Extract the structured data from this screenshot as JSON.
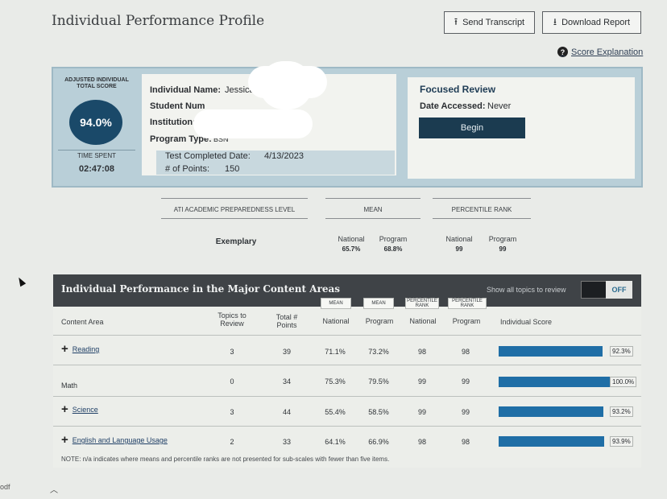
{
  "header": {
    "title": "Individual Performance Profile",
    "send_transcript": "Send Transcript",
    "download_report": "Download Report",
    "score_explanation": "Score Explanation"
  },
  "score": {
    "label": "ADJUSTED INDIVIDUAL TOTAL SCORE",
    "value": "94.0%",
    "time_label": "TIME SPENT",
    "time_value": "02:47:08"
  },
  "individual": {
    "name_label": "Individual Name:",
    "name_value": "Jessica",
    "student_label": "Student Num",
    "institution_label": "Institution:",
    "program_label": "Program Type:",
    "program_value": "BSN",
    "test_completed_label": "Test Completed Date:",
    "test_completed_value": "4/13/2023",
    "points_label": "# of Points:",
    "points_value": "150"
  },
  "focused_review": {
    "title": "Focused Review",
    "date_label": "Date Accessed:",
    "date_value": "Never",
    "begin": "Begin"
  },
  "summary": {
    "level_header": "ATI ACADEMIC PREPAREDNESS LEVEL",
    "level_value": "Exemplary",
    "mean_header": "MEAN",
    "percentile_header": "PERCENTILE RANK",
    "national_label": "National",
    "program_label": "Program",
    "mean_national": "65.7%",
    "mean_program": "68.8%",
    "pr_national": "99",
    "pr_program": "99"
  },
  "content": {
    "title": "Individual Performance in the Major Content Areas",
    "show_all": "Show all topics to review",
    "toggle": "OFF",
    "headers": {
      "content_area": "Content Area",
      "topics": "Topics to Review",
      "total": "Total # Points",
      "mean_box": "MEAN",
      "pr_box": "PERCENTILE RANK",
      "national": "National",
      "program": "Program",
      "individual_score": "Individual Score"
    },
    "rows": [
      {
        "name": "Reading",
        "topics": "3",
        "points": "39",
        "mean_nat": "71.1%",
        "mean_prog": "73.2%",
        "pr_nat": "98",
        "pr_prog": "98",
        "score": "92.3%",
        "score_frac": 0.923
      },
      {
        "name": "Math",
        "topics": "0",
        "points": "34",
        "mean_nat": "75.3%",
        "mean_prog": "79.5%",
        "pr_nat": "99",
        "pr_prog": "99",
        "score": "100.0%",
        "score_frac": 1.0
      },
      {
        "name": "Science",
        "topics": "3",
        "points": "44",
        "mean_nat": "55.4%",
        "mean_prog": "58.5%",
        "pr_nat": "99",
        "pr_prog": "99",
        "score": "93.2%",
        "score_frac": 0.932
      },
      {
        "name": "English and Language Usage",
        "topics": "2",
        "points": "33",
        "mean_nat": "64.1%",
        "mean_prog": "66.9%",
        "pr_nat": "98",
        "pr_prog": "98",
        "score": "93.9%",
        "score_frac": 0.939
      }
    ],
    "note": "NOTE: n/a indicates where means and percentile ranks are not presented for sub-scales with fewer than five items."
  },
  "footer": {
    "left_text": "odf"
  }
}
